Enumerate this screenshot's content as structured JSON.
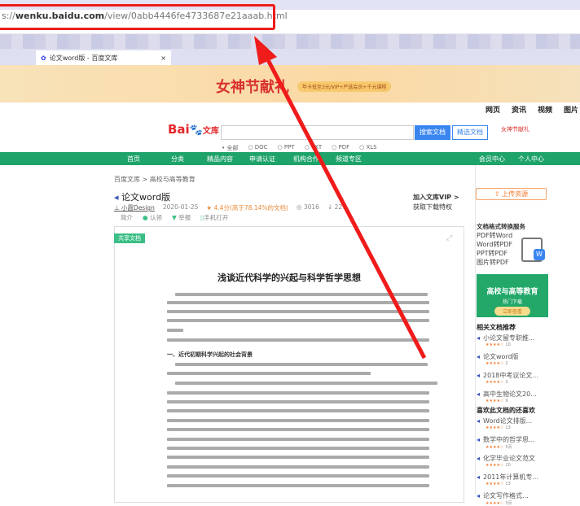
{
  "browser": {
    "url_prefix": "s://",
    "url_host": "wenku.baidu.com",
    "url_path": "/view/0abb4446fe4733687e21aaab.html",
    "tab_title": "论文word版 - 百度文库",
    "tab_close": "×"
  },
  "banner": {
    "title": "女神节献礼",
    "pill": "年卡低至3元/VIP+严选会员+千元课程"
  },
  "toplinks": [
    "网页",
    "资讯",
    "视频",
    "图片"
  ],
  "header": {
    "logo_main": "Bai",
    "logo_sub": "文库",
    "search_placeholder": "",
    "search_button": "搜索文档",
    "vip_button": "精选文档",
    "promo": "女神节献礼",
    "filters": [
      "全部",
      "DOC",
      "PPT",
      "TXT",
      "PDF",
      "XLS"
    ]
  },
  "nav": {
    "items": [
      "首页",
      "分类",
      "精品内容",
      "申请认证",
      "机构合作",
      "频道专区"
    ],
    "right": [
      "会员中心",
      "个人中心"
    ]
  },
  "doc": {
    "breadcrumb": "百度文库 > 高校与高等教育",
    "title": "论文word版",
    "author": "小霞Design",
    "date": "2020-01-25",
    "rating": "4.4分(高于78.14%的文档)",
    "views": "3016",
    "downloads": "227",
    "actions": [
      "简介",
      "认领",
      "举报",
      "手机打开"
    ],
    "tag": "共享文档",
    "paper_title": "浅谈近代科学的兴起与科学哲学思想",
    "section_heading": "一、近代初期科学兴起的社会背景"
  },
  "vip": {
    "title": "加入文库VIP >",
    "subtitle": "获取下载特权"
  },
  "sidebar": {
    "upload": "上传资源",
    "conv_title": "文档格式转换服务",
    "conv_items": [
      "PDF转Word",
      "Word转PDF",
      "PPT转PDF",
      "图片转PDF"
    ],
    "ad_title": "高校与高等教育",
    "ad_sub": "热门下载",
    "ad_button": "立即查看",
    "related_title": "相关文档推荐",
    "related": [
      {
        "t": "小论文留专职推...",
        "p": "10"
      },
      {
        "t": "论文word版",
        "p": "2"
      },
      {
        "t": "2018中考议论文...",
        "p": "3"
      },
      {
        "t": "高中生物论文20...",
        "p": "9"
      }
    ],
    "like_title": "喜欢此文档的还喜欢",
    "like": [
      {
        "t": "Word论文排版...",
        "p": "13"
      },
      {
        "t": "数学中的哲学思...",
        "p": "5页"
      },
      {
        "t": "化学毕业论文范文",
        "p": "20"
      },
      {
        "t": "2011年计算机专...",
        "p": "13"
      },
      {
        "t": "论文写作格式...",
        "p": "3页"
      }
    ]
  }
}
